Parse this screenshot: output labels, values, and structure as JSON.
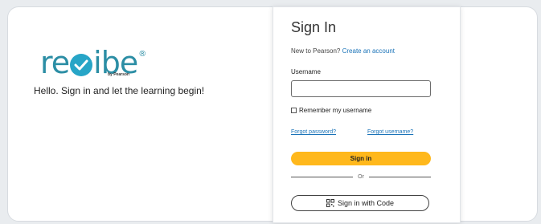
{
  "brand": {
    "logo_text_left": "re",
    "logo_text_right": "ibe",
    "logo_reg": "®",
    "byline": "by Pearson",
    "tagline": "Hello. Sign in and let the learning begin!",
    "accent": "#27a5c7"
  },
  "signin": {
    "title": "Sign In",
    "new_prefix": "New to Pearson?",
    "create_account": "Create an account",
    "username_label": "Username",
    "username_value": "",
    "remember_label": "Remember my username",
    "forgot_password": "Forgot password?",
    "forgot_username": "Forgot username?",
    "signin_button": "Sign in",
    "or_text": "Or",
    "code_button": "Sign in with Code",
    "code_icon": "qr-code-icon",
    "button_color": "#ffb81c",
    "link_color": "#1a73b8"
  }
}
